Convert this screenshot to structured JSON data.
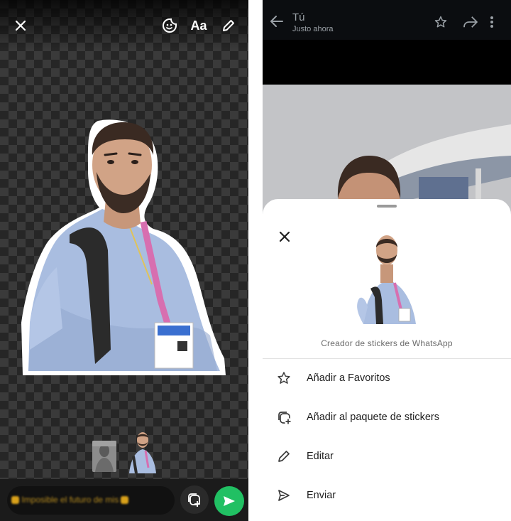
{
  "editor": {
    "toolbar": {
      "close_icon": "close-icon",
      "sticker_icon": "sticker-icon",
      "text_label": "Aa",
      "pencil_icon": "pencil-icon"
    },
    "caption": {
      "text": "Imposible el futuro de mis"
    },
    "colors": {
      "send_button": "#21c063"
    }
  },
  "viewer": {
    "header": {
      "title": "Tú",
      "subtitle": "Justo ahora"
    },
    "sheet": {
      "caption": "Creador de stickers de WhatsApp",
      "menu": [
        {
          "icon": "star-icon",
          "label": "Añadir a Favoritos"
        },
        {
          "icon": "add-to-pack-icon",
          "label": "Añadir al paquete de stickers"
        },
        {
          "icon": "pencil-icon",
          "label": "Editar"
        },
        {
          "icon": "send-icon",
          "label": "Enviar"
        }
      ]
    }
  }
}
